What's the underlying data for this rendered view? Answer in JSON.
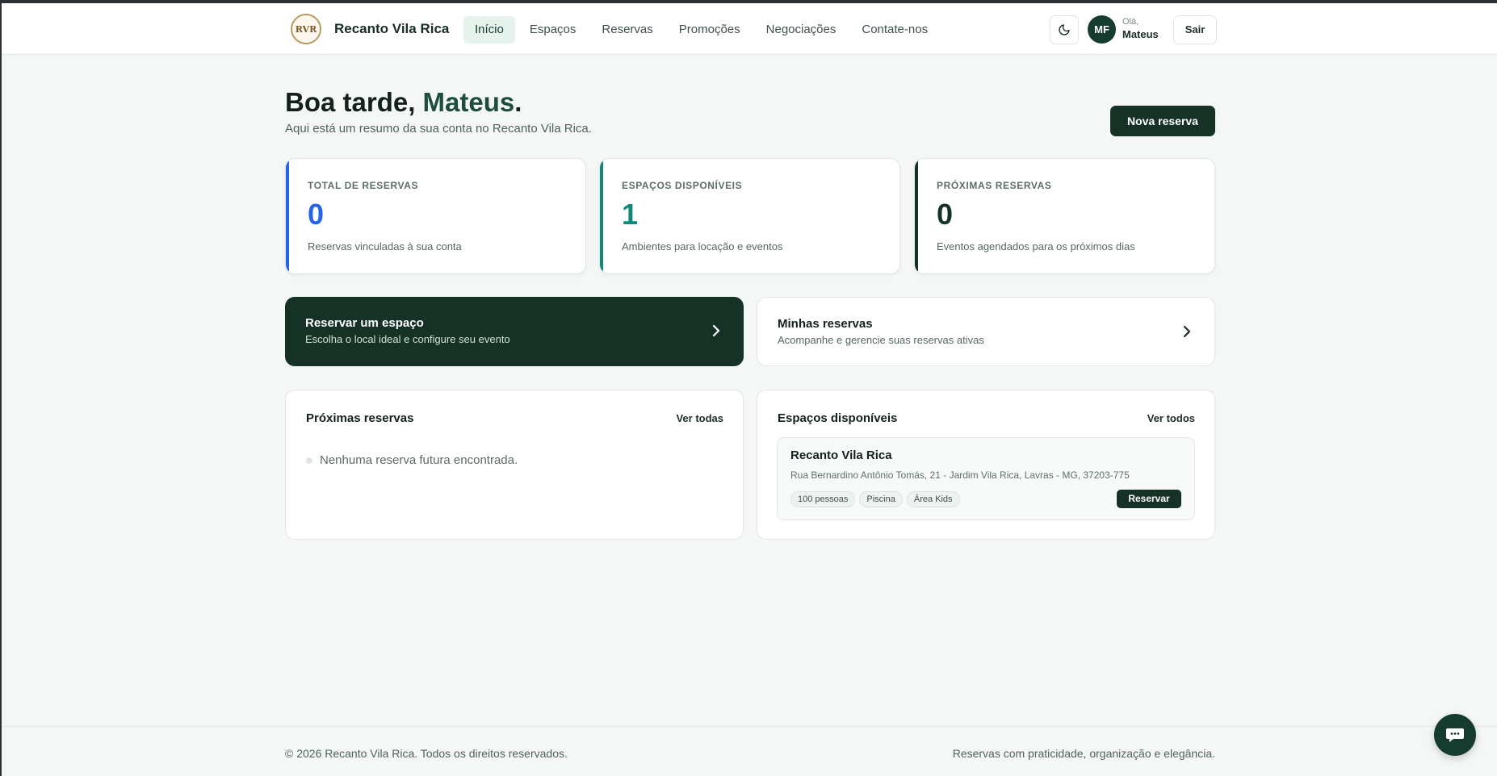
{
  "brand": {
    "name": "Recanto Vila Rica",
    "logo_text": "RVR"
  },
  "nav": {
    "items": [
      {
        "label": "Início",
        "active": true
      },
      {
        "label": "Espaços"
      },
      {
        "label": "Reservas"
      },
      {
        "label": "Promoções"
      },
      {
        "label": "Negociações"
      },
      {
        "label": "Contate-nos"
      }
    ]
  },
  "user": {
    "initials": "MF",
    "greeting": "Olá,",
    "name": "Mateus",
    "logout_label": "Sair",
    "theme_icon": "moon-icon"
  },
  "hero": {
    "greeting_prefix": "Boa tarde, ",
    "name": "Mateus",
    "suffix": ".",
    "subtitle": "Aqui está um resumo da sua conta no Recanto Vila Rica.",
    "new_button": "Nova reserva"
  },
  "stats": [
    {
      "label": "TOTAL DE RESERVAS",
      "value": "0",
      "desc": "Reservas vinculadas à sua conta",
      "color": "#2563eb"
    },
    {
      "label": "ESPAÇOS DISPONÍVEIS",
      "value": "1",
      "desc": "Ambientes para locação e eventos",
      "color": "#13877a"
    },
    {
      "label": "PRÓXIMAS RESERVAS",
      "value": "0",
      "desc": "Eventos agendados para os próximos dias",
      "color": "#163226"
    }
  ],
  "actions": [
    {
      "title": "Reservar um espaço",
      "subtitle": "Escolha o local ideal e configure seu evento"
    },
    {
      "title": "Minhas reservas",
      "subtitle": "Acompanhe e gerencie suas reservas ativas"
    }
  ],
  "upcoming": {
    "title": "Próximas reservas",
    "link": "Ver todas",
    "empty": "Nenhuma reserva futura encontrada."
  },
  "spaces": {
    "title": "Espaços disponíveis",
    "link": "Ver todos",
    "items": [
      {
        "name": "Recanto Vila Rica",
        "address": "Rua Bernardino Antônio Tomás, 21 - Jardim Vila Rica, Lavras - MG, 37203-775",
        "tags": [
          "100 pessoas",
          "Piscina",
          "Área Kids"
        ],
        "button": "Reservar"
      }
    ]
  },
  "footer": {
    "left": "© 2026 Recanto Vila Rica. Todos os direitos reservados.",
    "right": "Reservas com praticidade, organização e elegância."
  },
  "chat": {
    "icon": "chat-icon"
  }
}
